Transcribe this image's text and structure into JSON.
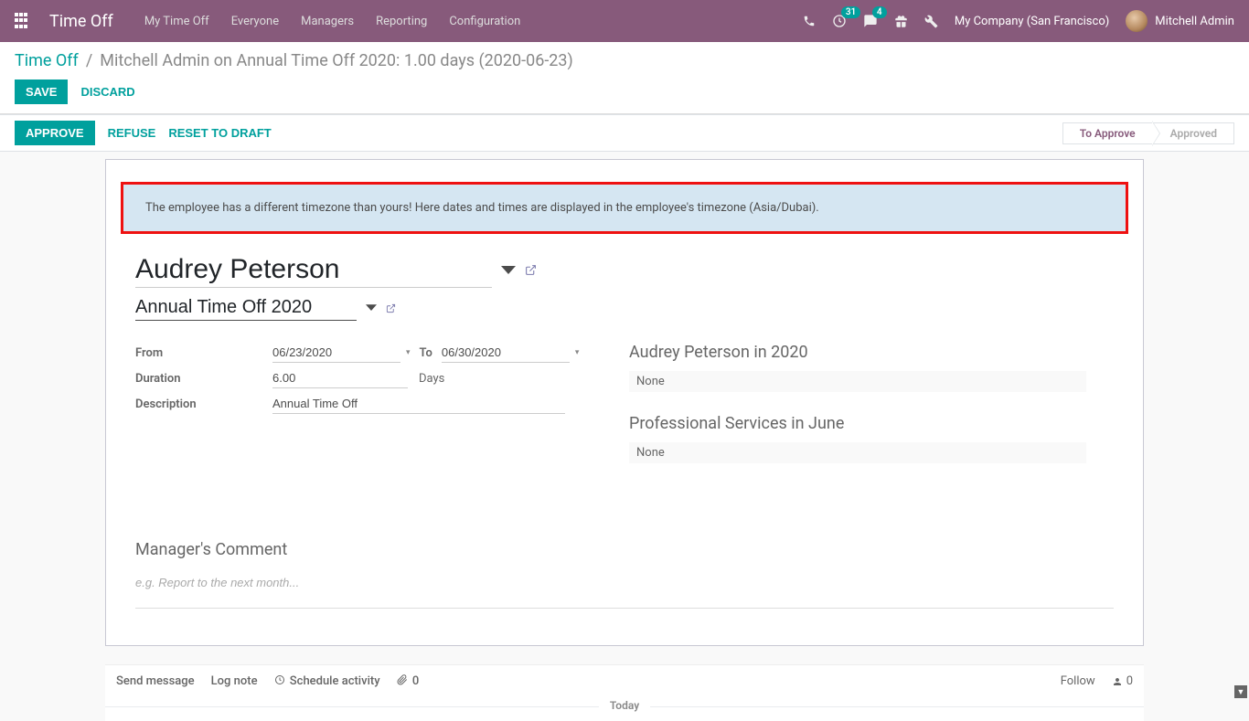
{
  "nav": {
    "brand": "Time Off",
    "menu": [
      "My Time Off",
      "Everyone",
      "Managers",
      "Reporting",
      "Configuration"
    ],
    "activity_badge": "31",
    "discuss_badge": "4",
    "company": "My Company (San Francisco)",
    "user": "Mitchell Admin"
  },
  "breadcrumb": {
    "root": "Time Off",
    "current": "Mitchell Admin on Annual Time Off 2020: 1.00 days (2020-06-23)"
  },
  "cp": {
    "save": "Save",
    "discard": "Discard"
  },
  "status": {
    "approve": "Approve",
    "refuse": "Refuse",
    "reset": "Reset to Draft",
    "to_approve": "To Approve",
    "approved": "Approved"
  },
  "alert": "The employee has a different timezone than yours! Here dates and times are displayed in the employee's timezone (Asia/Dubai).",
  "form": {
    "employee": "Audrey Peterson",
    "leave_type": "Annual Time Off 2020",
    "from_label": "From",
    "date_from": "06/23/2020",
    "to_label": "To",
    "date_to": "06/30/2020",
    "duration_label": "Duration",
    "duration": "6.00",
    "days": "Days",
    "description_label": "Description",
    "description": "Annual Time Off"
  },
  "right": {
    "sec1_title": "Audrey Peterson in 2020",
    "sec1_val": "None",
    "sec2_title": "Professional Services in June",
    "sec2_val": "None"
  },
  "manager": {
    "title": "Manager's Comment",
    "placeholder": "e.g. Report to the next month..."
  },
  "chatter": {
    "send": "Send message",
    "log": "Log note",
    "activity": "Schedule activity",
    "attach_count": "0",
    "follow": "Follow",
    "followers": "0",
    "today": "Today"
  }
}
